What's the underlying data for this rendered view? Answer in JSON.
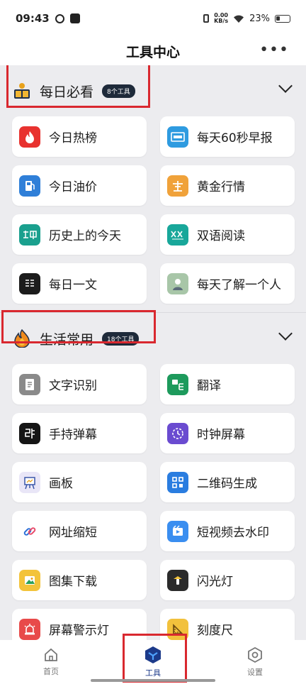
{
  "status_bar": {
    "time": "09:43",
    "netspeed_value": "0.00",
    "netspeed_unit": "KB/s",
    "battery": "23%"
  },
  "header": {
    "title": "工具中心",
    "more": "•••"
  },
  "sections": [
    {
      "title": "每日必看",
      "badge": "8个工具",
      "tools": [
        {
          "label": "今日热榜",
          "icon": "flame-icon",
          "color": "#e8322f"
        },
        {
          "label": "每天60秒早报",
          "icon": "news-icon",
          "color": "#2e9be0"
        },
        {
          "label": "今日油价",
          "icon": "fuel-icon",
          "color": "#2f7fd8"
        },
        {
          "label": "黄金行情",
          "icon": "gold-icon",
          "color": "#f0a23a"
        },
        {
          "label": "历史上的今天",
          "icon": "history-icon",
          "color": "#1aa08e"
        },
        {
          "label": "双语阅读",
          "icon": "bilingual-icon",
          "color": "#18a79a"
        },
        {
          "label": "每日一文",
          "icon": "article-icon",
          "color": "#1c1c1c"
        },
        {
          "label": "每天了解一个人",
          "icon": "person-icon",
          "color": "#a8c6a8"
        }
      ]
    },
    {
      "title": "生活常用",
      "badge": "18个工具",
      "tools": [
        {
          "label": "文字识别",
          "icon": "ocr-icon",
          "color": "#8a8a8a"
        },
        {
          "label": "翻译",
          "icon": "translate-icon",
          "color": "#1d9a5c"
        },
        {
          "label": "手持弹幕",
          "icon": "danmaku-icon",
          "color": "#151515"
        },
        {
          "label": "时钟屏幕",
          "icon": "clock-icon",
          "color": "#6a4bd0"
        },
        {
          "label": "画板",
          "icon": "easel-icon",
          "color": "#e9e6f7"
        },
        {
          "label": "二维码生成",
          "icon": "qrcode-icon",
          "color": "#2a7de0"
        },
        {
          "label": "网址缩短",
          "icon": "link-icon",
          "color": "#ffffff"
        },
        {
          "label": "短视频去水印",
          "icon": "video-icon",
          "color": "#3a8ef0"
        },
        {
          "label": "图集下载",
          "icon": "gallery-icon",
          "color": "#f3c33a"
        },
        {
          "label": "闪光灯",
          "icon": "flashlight-icon",
          "color": "#2b2b2b"
        },
        {
          "label": "屏幕警示灯",
          "icon": "alarm-icon",
          "color": "#e84a4a"
        },
        {
          "label": "刻度尺",
          "icon": "ruler-icon",
          "color": "#f2c13c"
        }
      ]
    }
  ],
  "nav": [
    {
      "label": "首页",
      "icon": "home-icon"
    },
    {
      "label": "工具",
      "icon": "tools-icon"
    },
    {
      "label": "设置",
      "icon": "settings-icon"
    }
  ],
  "colors": {
    "accent": "#1c3a8a",
    "highlight_box": "#d9282f",
    "badge": "#1e2a3a"
  }
}
